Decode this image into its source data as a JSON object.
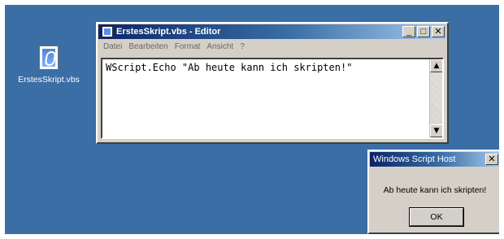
{
  "desktop": {
    "background_color": "#3a6ea5",
    "icons": [
      {
        "label": "ErstesSkript.vbs",
        "icon": "vbs-file-icon"
      }
    ]
  },
  "editor": {
    "title": "ErstesSkript.vbs - Editor",
    "title_icon": "notepad-icon",
    "titlebar_buttons": {
      "minimize": "_",
      "maximize": "□",
      "close": "✕"
    },
    "menu": [
      "Datei",
      "Bearbeiten",
      "Format",
      "Ansicht",
      "?"
    ],
    "content": "WScript.Echo \"Ab heute kann ich skripten!\"",
    "scrollbar": {
      "up_glyph": "▲",
      "down_glyph": "▼"
    }
  },
  "msgbox": {
    "title": "Windows Script Host",
    "close": "✕",
    "message": "Ab heute kann ich skripten!",
    "ok_label": "OK"
  }
}
